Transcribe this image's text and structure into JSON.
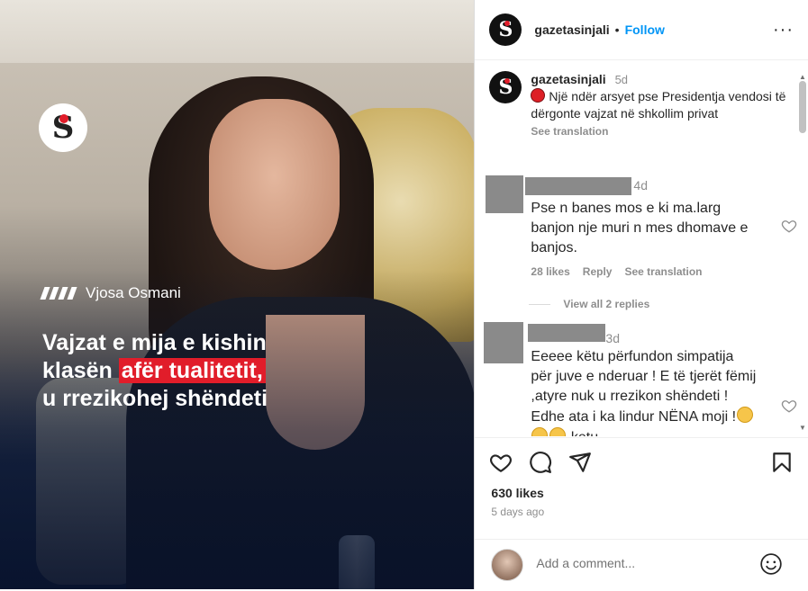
{
  "media": {
    "overlay_name": "Vjosa Osmani",
    "headline_line1": "Vajzat e mija e kishin",
    "headline_line2a": "klasën",
    "headline_line2b": "afër tualitetit,",
    "headline_line3": "u rrezikohej shëndeti"
  },
  "header": {
    "username": "gazetasinjali",
    "dot": "•",
    "follow_label": "Follow",
    "more_label": "···"
  },
  "caption": {
    "username": "gazetasinjali",
    "time": "5d",
    "text": "Një ndër arsyet pse Presidentja vendosi të dërgonte vajzat në shkollim privat",
    "see_translation": "See translation"
  },
  "comments": [
    {
      "time": "4d",
      "text": "Pse n banes mos e ki ma.larg banjon nje muri n mes dhomave e banjos.",
      "likes": "28 likes",
      "reply": "Reply",
      "see_translation": "See translation",
      "view_replies": "View all 2 replies"
    },
    {
      "time": "3d",
      "text": "Eeeee këtu përfundon simpatija për juve e nderuar ! E të tjerët fëmij ,atyre nuk u rrezikon shëndeti ! Edhe ata i ka lindur",
      "text_tail": "NËNA moji !",
      "text_after": "ketu"
    }
  ],
  "footer": {
    "likes": "630 likes",
    "ago": "5 days ago",
    "add_comment_placeholder": "Add a comment..."
  },
  "colors": {
    "brand_red": "#e11d2a",
    "link_blue": "#0095f6"
  }
}
